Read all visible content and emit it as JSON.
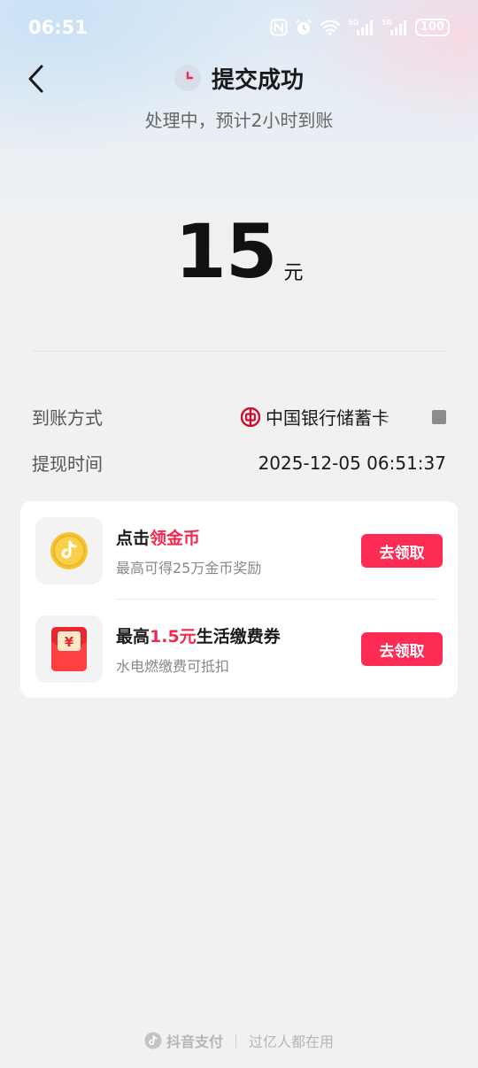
{
  "status_bar": {
    "time": "06:51",
    "battery": "100",
    "signal_label_1": "5G",
    "signal_label_2": "5G"
  },
  "header": {
    "title": "提交成功",
    "subtitle": "处理中，预计2小时到账"
  },
  "amount": {
    "value": "15",
    "unit": "元"
  },
  "details": {
    "method_label": "到账方式",
    "method_value": "中国银行储蓄卡",
    "time_label": "提现时间",
    "time_value": "2025-12-05 06:51:37"
  },
  "rewards": [
    {
      "title_prefix": "点击",
      "title_highlight": "领金币",
      "title_suffix": "",
      "desc": "最高可得25万金币奖励",
      "button": "去领取",
      "icon": "tiktok-coin-icon"
    },
    {
      "title_prefix": "最高",
      "title_highlight": "1.5元",
      "title_suffix": "生活缴费券",
      "desc": "水电燃缴费可抵扣",
      "button": "去领取",
      "icon": "red-envelope-icon"
    }
  ],
  "footer": {
    "brand": "抖音支付",
    "slogan": "过亿人都在用"
  },
  "colors": {
    "accent": "#fe2c55",
    "highlight_text": "#f0294f",
    "coin": "#f7c331",
    "envelope": "#e8262f"
  }
}
